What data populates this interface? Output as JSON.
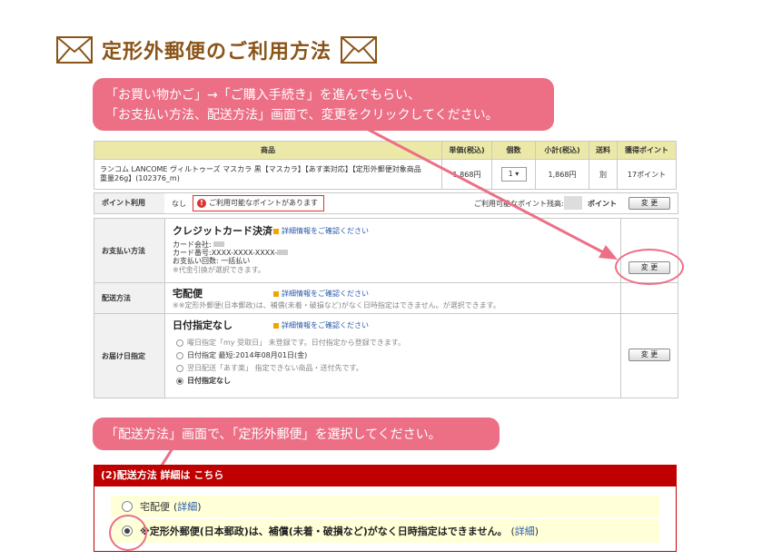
{
  "title": "定形外郵便のご利用方法",
  "callout1": {
    "line1": "「お買い物かご」→「ご購入手続き」を進んでもらい、",
    "line2": "「お支払い方法、配送方法」画面で、変更をクリックしてください。"
  },
  "callout2": "「配送方法」画面で、「定形外郵便」を選択してください。",
  "product_table": {
    "headers": [
      "商品",
      "単価(税込)",
      "個数",
      "小計(税込)",
      "送料",
      "獲得ポイント"
    ],
    "row": {
      "name_line1": "ランコム LANCOME ヴィルトゥーズ マスカラ 黒【マスカラ】【あす楽対応】【定形外郵便対象商品",
      "name_line2": "重量26g】(102376_m)",
      "price": "1,868円",
      "qty": "1",
      "subtotal": "1,868円",
      "shipping": "別",
      "points": "17ポイント"
    }
  },
  "points_row": {
    "label": "ポイント利用",
    "value": "なし",
    "notice": "ご利用可能なポイントがあります",
    "available_label": "ご利用可能なポイント残高:",
    "unit": "ポイント",
    "button": "変 更"
  },
  "payment": {
    "label": "お支払い方法",
    "heading": "クレジットカード決済",
    "link": "詳細情報をご確認ください",
    "card_company": "カード会社:",
    "card_number": "カード番号:XXXX-XXXX-XXXX-",
    "installments": "お支払い回数: 一括払い",
    "note": "※代金引換が選択できます。",
    "button": "変 更"
  },
  "delivery": {
    "label": "配送方法",
    "heading": "宅配便",
    "link": "詳細情報をご確認ください",
    "note": "※※定形外郵便(日本郵政)は、補償(未着・破損など)がなく日時指定はできません。が選択できます。"
  },
  "date": {
    "label": "お届け日指定",
    "heading": "日付指定なし",
    "link": "詳細情報をご確認ください",
    "opt1": "曜日指定「my 受取日」 未登録です。日付指定から登録できます。",
    "opt2": "日付指定 最短:2014年08月01日(金)",
    "opt3": "翌日配送「あす楽」 指定できない商品・送付先です。",
    "opt4": "日付指定なし",
    "button": "変 更"
  },
  "bottom": {
    "section_title": "(2)配送方法 詳細は こちら",
    "opt1_label": "宅配便",
    "opt1_link": "詳細",
    "opt2_label": "※定形外郵便(日本郵政)は、補償(未着・破損など)がなく日時指定はできません。",
    "opt2_link": "詳細"
  },
  "colors": {
    "callout": "#ec6f86",
    "title": "#8a5418",
    "section_bar": "#c00000",
    "table_header": "#ece9a8",
    "option_bg": "#ffffd8"
  }
}
